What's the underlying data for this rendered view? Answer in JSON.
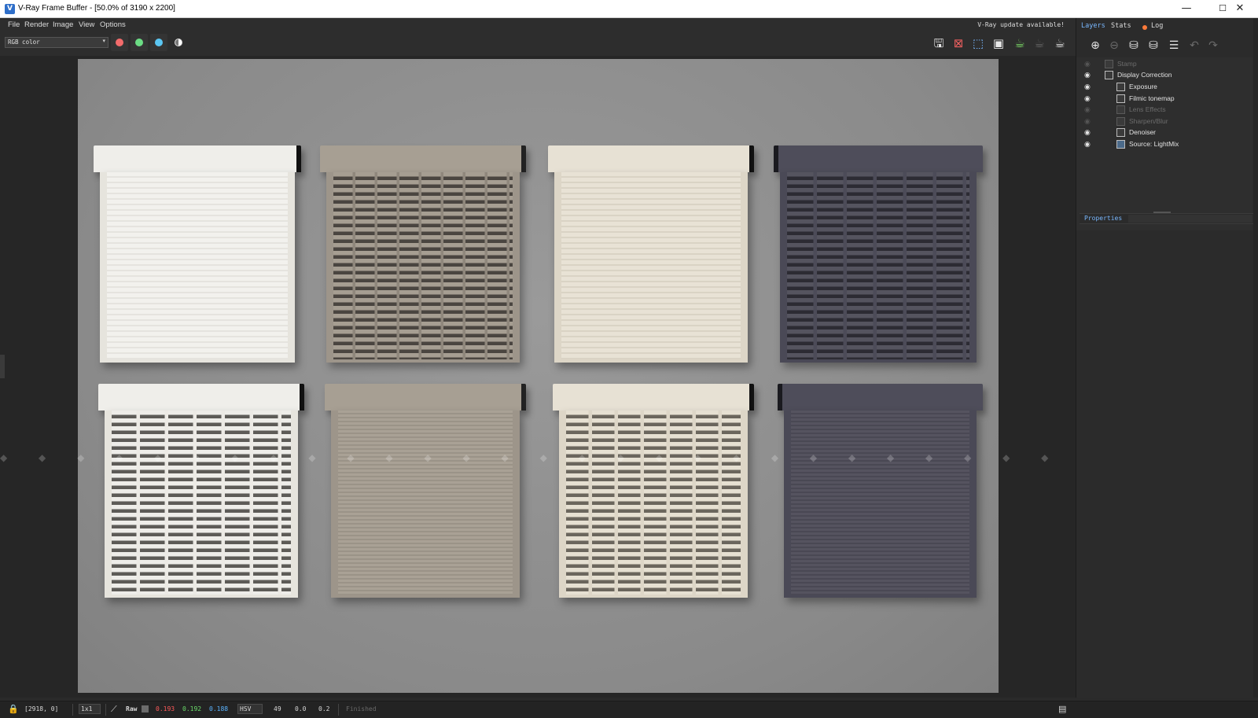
{
  "window": {
    "title": "V-Ray Frame Buffer - [50.0% of 3190 x 2200]",
    "app_icon": "V",
    "minimize": "—",
    "maximize": "☐",
    "close": "✕"
  },
  "menu": {
    "items": [
      "File",
      "Render",
      "Image",
      "View",
      "Options"
    ],
    "update_notice": "V-Ray update available!"
  },
  "toolbar": {
    "channel_select": "RGB color",
    "channel_buttons": [
      {
        "name": "red-channel",
        "color": "#f26b6b"
      },
      {
        "name": "green-channel",
        "color": "#6bdc84"
      },
      {
        "name": "blue-channel",
        "color": "#5bc6f2"
      }
    ],
    "tools": [
      "save-icon",
      "clear-icon",
      "region-icon",
      "compare-icon",
      "render-teapot-icon",
      "render-interactive-icon",
      "render-teapot-icon"
    ]
  },
  "watermark": "◆ ◆ ◆ ◆ ◆ ◆ ◆ ◆ ◆ ◆ ◆ ◆ ◆ ◆ ◆ ◆ ◆ ◆ ◆ ◆ ◆ ◆ ◆ ◆ ◆ ◆ ◆ ◆ ◆ ◆ ◆ ◆ ◆ ◆ ◆ ◆ ◆ ◆ ◆ ◆ ◆ ◆ ◆ ◆ ◆",
  "panel": {
    "tabs": [
      "Layers",
      "Stats",
      "Log"
    ],
    "layers": [
      {
        "label": "Stamp",
        "enabled": false,
        "indent": 0
      },
      {
        "label": "Display Correction",
        "enabled": true,
        "indent": 0
      },
      {
        "label": "Exposure",
        "enabled": true,
        "indent": 1
      },
      {
        "label": "Filmic tonemap",
        "enabled": true,
        "indent": 1
      },
      {
        "label": "Lens Effects",
        "enabled": false,
        "indent": 1
      },
      {
        "label": "Sharpen/Blur",
        "enabled": false,
        "indent": 1
      },
      {
        "label": "Denoiser",
        "enabled": true,
        "indent": 1
      },
      {
        "label": "Source: LightMix",
        "enabled": true,
        "indent": 1
      }
    ],
    "properties_label": "Properties"
  },
  "status": {
    "coords": "[2918, 0]",
    "zoom": "1x1",
    "mode": "Raw",
    "r": "0.193",
    "g": "0.192",
    "b": "0.188",
    "color_space": "HSV",
    "v1": "49",
    "v2": "0.0",
    "v3": "0.2",
    "state": "Finished",
    "colors": {
      "r": "#ff5a5a",
      "g": "#6bdc6b",
      "b": "#5ab4ff"
    }
  }
}
